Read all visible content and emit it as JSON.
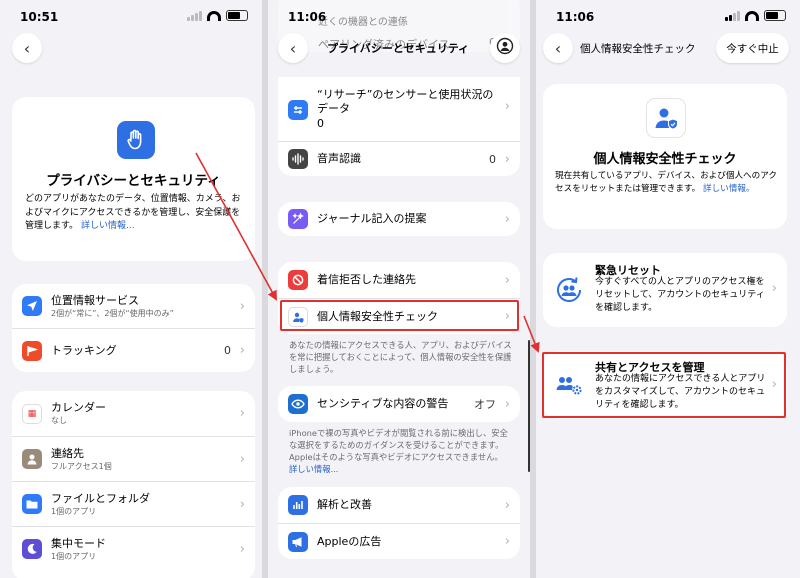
{
  "screen1": {
    "time": "10:51",
    "hero": {
      "title": "プライバシーとセキュリティ",
      "desc": "どのアプリがあなたのデータ、位置情報、カメラ、およびマイクにアクセスできるかを管理し、安全保護を管理します。",
      "link": "詳しい情報..."
    },
    "group1": [
      {
        "label": "位置情報サービス",
        "sub": "2個が“常に”、2個が“使用中のみ”",
        "value": ""
      },
      {
        "label": "トラッキング",
        "sub": "",
        "value": "0"
      }
    ],
    "group2": [
      {
        "label": "カレンダー",
        "sub": "なし"
      },
      {
        "label": "連絡先",
        "sub": "フルアクセス1個"
      },
      {
        "label": "ファイルとフォルダ",
        "sub": "1個のアプリ"
      },
      {
        "label": "集中モード",
        "sub": "1個のアプリ"
      }
    ]
  },
  "screen2": {
    "time": "11:06",
    "nav_title": "プライバシーとセキュリティ",
    "faded_top": "近くの機器との連係",
    "faded_row": "ペアリング済みのデバイス",
    "faded_row_value": "0",
    "research": {
      "label": "“リサーチ”のセンサーと使用状況のデータ",
      "value": "0"
    },
    "speech": {
      "label": "音声認識",
      "value": "0"
    },
    "journal": {
      "label": "ジャーナル記入の提案"
    },
    "blocked": {
      "label": "着信拒否した連絡先"
    },
    "safety": {
      "label": "個人情報安全性チェック"
    },
    "safety_note": "あなたの情報にアクセスできる人、アプリ、およびデバイスを常に把握しておくことによって、個人情報の安全性を保護しましょう。",
    "sensitive": {
      "label": "センシティブな内容の警告",
      "value": "オフ"
    },
    "sensitive_note": "iPhoneで裸の写真やビデオが閲覧される前に検出し、安全な選択をするためのガイダンスを受けることができます。Appleはそのような写真やビデオにアクセスできません。",
    "sensitive_link": "詳しい情報...",
    "analytics": {
      "label": "解析と改善"
    },
    "ads": {
      "label": "Appleの広告"
    }
  },
  "screen3": {
    "time": "11:06",
    "nav_title": "個人情報安全性チェック",
    "stop_button": "今すぐ中止",
    "hero": {
      "title": "個人情報安全性チェック",
      "desc": "現在共有しているアプリ、デバイス、および個人へのアクセスをリセットまたは管理できます。",
      "link": "詳しい情報。"
    },
    "emergency": {
      "label": "緊急リセット",
      "desc": "今すぐすべての人とアプリのアクセス権をリセットして、アカウントのセキュリティを確認します。"
    },
    "manage": {
      "label": "共有とアクセスを管理",
      "desc": "あなたの情報にアクセスできる人とアプリをカスタマイズして、アカウントのセキュリティを確認します。"
    }
  },
  "colors": {
    "highlight": "#e03030",
    "link": "#2563c9",
    "blue": "#2f6fe4",
    "red": "#ee3b3b"
  }
}
